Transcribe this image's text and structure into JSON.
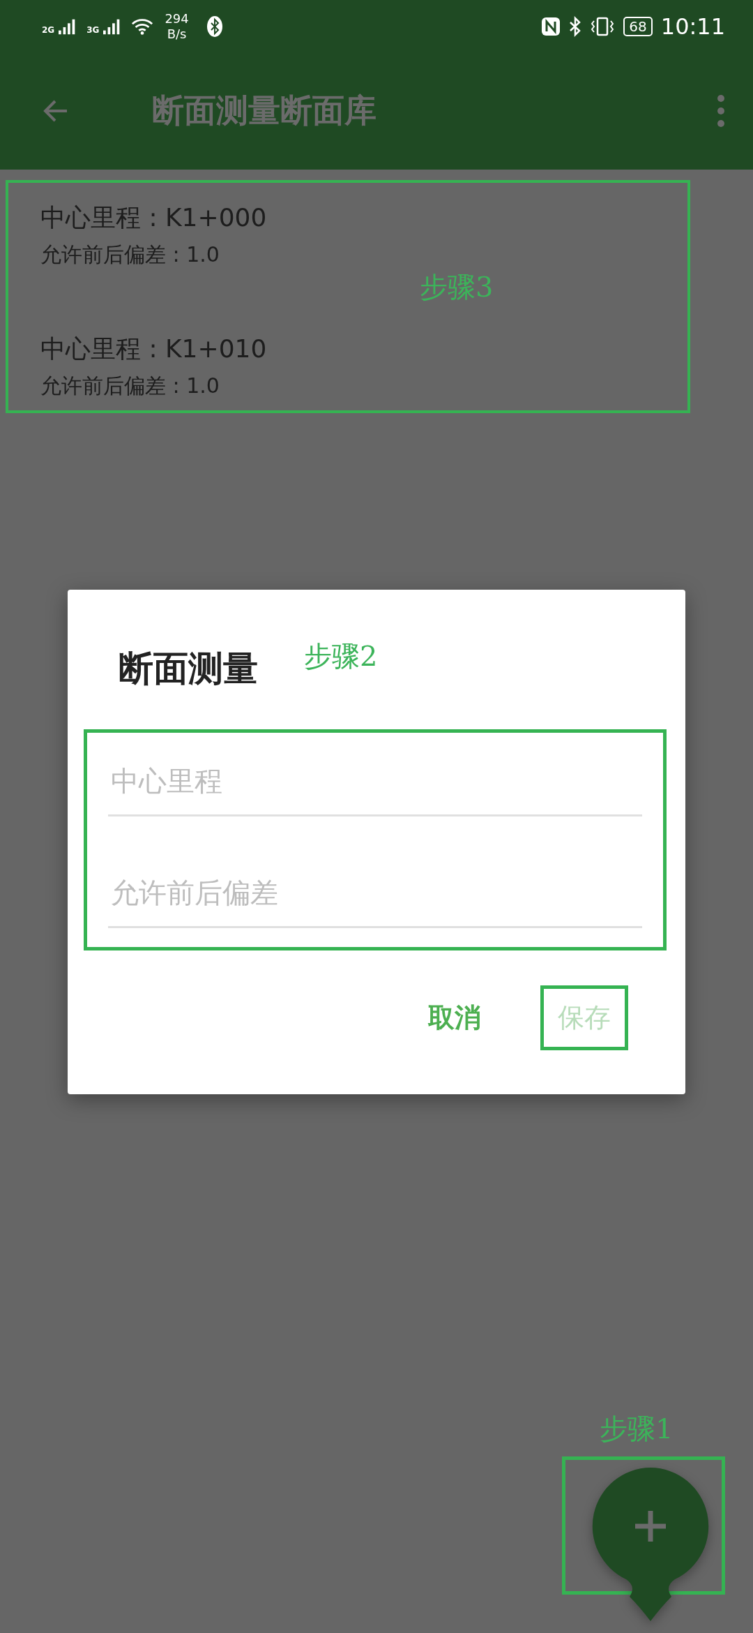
{
  "status_bar": {
    "signal_1": "2G",
    "signal_2": "3G",
    "net_speed": "294",
    "net_speed_unit": "B/s",
    "battery": "68",
    "time": "10:11"
  },
  "app_bar": {
    "title": "断面测量断面库"
  },
  "list": {
    "annotation": "步骤3",
    "items": [
      {
        "mileage": "中心里程 : K1+000",
        "tolerance": "允许前后偏差 : 1.0"
      },
      {
        "mileage": "中心里程 : K1+010",
        "tolerance": "允许前后偏差 : 1.0"
      }
    ]
  },
  "dialog": {
    "title": "断面测量",
    "annotation": "步骤2",
    "fields": [
      {
        "placeholder": "中心里程"
      },
      {
        "placeholder": "允许前后偏差"
      }
    ],
    "buttons": [
      {
        "label": "取消",
        "disabled": false,
        "highlighted": false
      },
      {
        "label": "保存",
        "disabled": true,
        "highlighted": true
      }
    ]
  },
  "fab": {
    "annotation": "步骤1"
  }
}
